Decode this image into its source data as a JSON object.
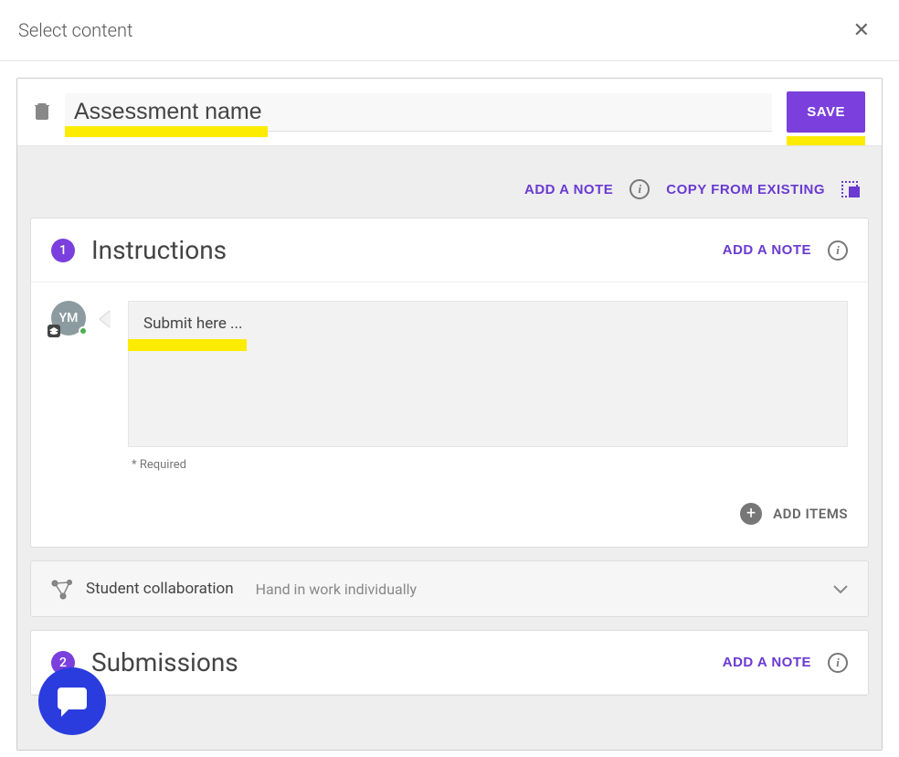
{
  "modal": {
    "title": "Select content"
  },
  "toolbar": {
    "name_placeholder": "Assessment name",
    "save_label": "SAVE"
  },
  "top_actions": {
    "add_note_label": "ADD A NOTE",
    "copy_label": "COPY FROM EXISTING"
  },
  "sections": {
    "instructions": {
      "number": "1",
      "title": "Instructions",
      "add_note_label": "ADD A NOTE",
      "avatar_initials": "YM",
      "textarea_value": "Submit here ...",
      "required_note": "* Required",
      "add_items_label": "ADD ITEMS"
    },
    "collab": {
      "title": "Student collaboration",
      "subtitle": "Hand in work individually"
    },
    "submissions": {
      "number": "2",
      "title": "Submissions",
      "add_note_label": "ADD A NOTE"
    }
  }
}
